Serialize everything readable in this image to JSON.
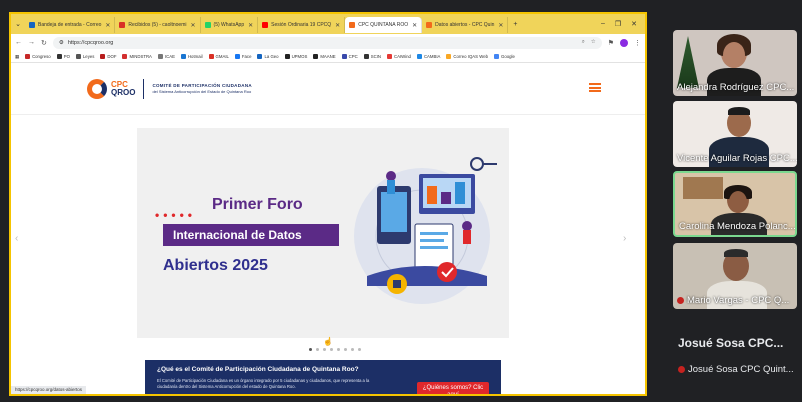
{
  "tabs": [
    {
      "label": "Bandeja de entrada - Correo",
      "color": "#1565c0"
    },
    {
      "label": "Recibidos (5) - caoltnoemi",
      "color": "#d93025"
    },
    {
      "label": "(5) WhatsApp",
      "color": "#25d366"
    },
    {
      "label": "Sesión Ordinaria 19 CPCQ",
      "color": "#ff0000"
    },
    {
      "label": "CPC QUINTANA ROO",
      "color": "#f26a1b",
      "active": true
    },
    {
      "label": "Datos abiertos - CPC Quin",
      "color": "#f26a1b"
    }
  ],
  "window_controls": {
    "minimize": "–",
    "maximize": "❐",
    "close": "✕"
  },
  "address": {
    "url": "https://cpcqroo.org"
  },
  "bookmarks": [
    "Congreso",
    "PO",
    "Leyes",
    "DOF",
    "MINDSTRA",
    "ICAE",
    "Hotmail",
    "GMAIL",
    "Face",
    "La Geo",
    "UPMOS",
    "MAANE",
    "CPC",
    "SCIN",
    "CAIWind",
    "CAMBIA",
    "Correo IQAS Web",
    "Google"
  ],
  "site": {
    "logo_top": "CPC",
    "logo_bottom": "QROO",
    "org_title": "COMITÉ DE PARTICIPACIÓN CIUDADANA",
    "org_subtitle": "del Sistema Anticorrupción del Estado de Quintana Roo"
  },
  "banner": {
    "line1": "Primer Foro",
    "line2": "Internacional de Datos",
    "line3": "Abiertos 2025"
  },
  "info": {
    "heading": "¿Qué es el Comité de Participación Ciudadana de Quintana Roo?",
    "body": "El Comité de Participación Ciudadana es un órgano integrado por 5 ciudadanas y ciudadanos, que representa a la ciudadanía dentro del Sistema Anticorrupción del estado de Quintana Roo.",
    "button": "¿Quiénes somos? Clic aquí"
  },
  "statusbar": {
    "link": "https://cpcqroo.org/datos-abiertos"
  },
  "participants": [
    {
      "name": "Alejandra Rodríguez CPC..."
    },
    {
      "name": "Vicente Aguilar Rojas CPC..."
    },
    {
      "name": "Carolina Mendoza Polanc...",
      "active": true
    },
    {
      "name": "Mario Vargas - CPC Q..."
    }
  ],
  "bottom": {
    "big_name": "Josué Sosa CPC...",
    "small_name": "Josué Sosa CPC Quint..."
  },
  "colors": {
    "accent": "#f26a1b",
    "navy": "#1c2f66",
    "purple": "#5b2a86",
    "red": "#e0282b"
  }
}
